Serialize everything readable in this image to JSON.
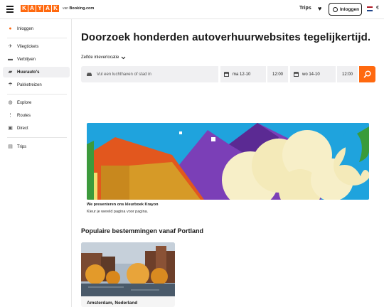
{
  "header": {
    "logo_letters": [
      "K",
      "A",
      "Y",
      "A",
      "K"
    ],
    "via_text": "van",
    "partner": "Booking.com",
    "trips_label": "Trips",
    "login_label": "Inloggen",
    "currency_partial": "€"
  },
  "sidebar": {
    "items": [
      {
        "label": "Inloggen",
        "icon": "user-icon"
      },
      {
        "label": "Vliegtickets",
        "icon": "plane-icon"
      },
      {
        "label": "Verblijven",
        "icon": "bed-icon"
      },
      {
        "label": "Huurauto's",
        "icon": "car-icon",
        "active": true
      },
      {
        "label": "Pakketreizen",
        "icon": "umbrella-icon"
      },
      {
        "label": "Explore",
        "icon": "globe-icon"
      },
      {
        "label": "Routes",
        "icon": "route-icon"
      },
      {
        "label": "Direct",
        "icon": "direct-icon"
      },
      {
        "label": "Trips",
        "icon": "suitcase-icon"
      }
    ]
  },
  "main": {
    "title": "Doorzoek honderden autoverhuurwebsites tegelijkertijd.",
    "same_location": "Zelfde inleverlocatie",
    "search": {
      "location_placeholder": "Vul een luchthaven of stad in",
      "pickup_date": "ma 12-10",
      "pickup_time": "12:00",
      "dropoff_date": "wo 14-10",
      "dropoff_time": "12:00"
    },
    "promo": {
      "title": "We presenteren ons kleurboek Krayon",
      "subtitle": "Kleur je wereld pagina voor pagina."
    },
    "popular": {
      "title": "Populaire bestemmingen vanaf Portland",
      "cards": [
        {
          "label": "Amsterdam, Nederland"
        }
      ]
    }
  },
  "colors": {
    "accent": "#ff690f",
    "active_bg": "#f0f0f2"
  }
}
